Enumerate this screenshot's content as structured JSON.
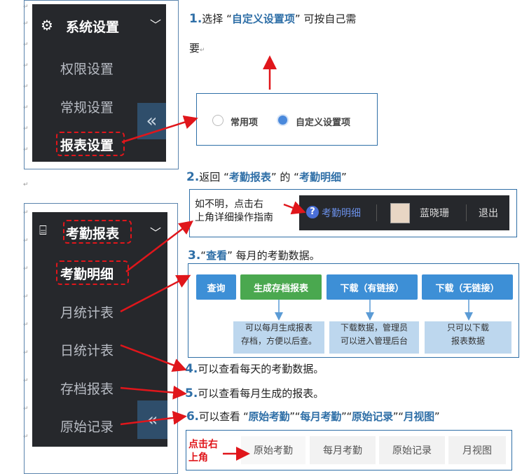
{
  "menu1": {
    "header": "系统设置",
    "items": [
      "权限设置",
      "常规设置",
      "报表设置"
    ],
    "collapse": "«"
  },
  "menu2": {
    "header": "考勤报表",
    "items": [
      "考勤明细",
      "月统计表",
      "日统计表",
      "存档报表",
      "原始记录"
    ],
    "collapse": "«"
  },
  "step1": {
    "num": "1.",
    "pre": "选择 “",
    "hl": "自定义设置项",
    "post": "” 可按自己需",
    "line2": "要"
  },
  "radios": {
    "common": "常用项",
    "custom": "自定义设置项",
    "selected": "custom"
  },
  "step2": {
    "num": "2.",
    "pre": "返回 “",
    "hl1": "考勤报表",
    "mid": "” 的 “",
    "hl2": "考勤明细",
    "post": "”"
  },
  "hint": {
    "line1": "如不明，点击右",
    "line2": "上角详细操作指南"
  },
  "topbar": {
    "help": "考勤明细",
    "user": "蓝晓珊",
    "logout": "退出"
  },
  "step3": {
    "num": "3.",
    "pre": "“",
    "hl": "查看",
    "post": "” 每月的考勤数据。"
  },
  "buttons": [
    {
      "label": "查询",
      "color": "#3d8fd6"
    },
    {
      "label": "生成存档报表",
      "color": "#4aa84f"
    },
    {
      "label": "下载（有链接）",
      "color": "#3d8fd6"
    },
    {
      "label": "下载（无链接）",
      "color": "#3d8fd6"
    }
  ],
  "notes": [
    {
      "line1": "可以每月生成报表",
      "line2": "存档，方便以后查。"
    },
    {
      "line1": "下载数据，管理员",
      "line2": "可以进入管理后台"
    },
    {
      "line1": "只可以下载",
      "line2": "报表数据"
    }
  ],
  "step4": {
    "num": "4.",
    "text": "可以查看每天的考勤数据。"
  },
  "step5": {
    "num": "5.",
    "text": "可以查看每月生成的报表。"
  },
  "step6": {
    "num": "6.",
    "pre": "可以查看 “",
    "hl1": "原始考勤",
    "s1": "”“",
    "hl2": "每月考勤",
    "s2": "”“",
    "hl3": "原始记录",
    "s3": "”“",
    "hl4": "月视图",
    "post": "”"
  },
  "click_hint": {
    "line1": "点击右",
    "line2": "上角"
  },
  "tabs": [
    "原始考勤",
    "每月考勤",
    "原始记录",
    "月视图"
  ],
  "colors": {
    "accent": "#2f6fa7",
    "arrow": "#e0161b",
    "dark": "#26282c"
  }
}
